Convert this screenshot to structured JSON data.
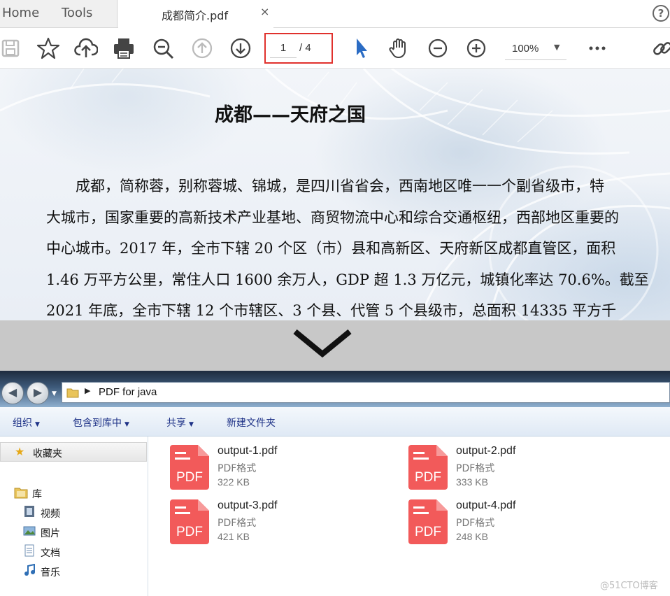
{
  "viewer": {
    "tabs": {
      "home": "Home",
      "tools": "Tools",
      "doc": "成都简介.pdf",
      "close": "×"
    },
    "help": "?",
    "toolbar": {
      "icons": [
        "save-icon",
        "star-icon",
        "upload-icon",
        "print-icon",
        "search-icon",
        "page-up-icon",
        "page-down-icon",
        "cursor-icon",
        "hand-icon",
        "zoom-out-icon",
        "zoom-in-icon",
        "more-icon",
        "link-icon"
      ],
      "page_current": "1",
      "page_total": "/ 4",
      "zoom": "100%"
    },
    "document": {
      "title": "成都——天府之国",
      "lines": [
        "　　成都，简称蓉，别称蓉城、锦城，是四川省省会，西南地区唯一一个副省级市，特",
        "大城市，国家重要的高新技术产业基地、商贸物流中心和综合交通枢纽，西部地区重要的",
        "中心城市。2017 年，全市下辖 20 个区（市）县和高新区、天府新区成都直管区，面积",
        "1.46 万平方公里，常住人口 1600 余万人，GDP 超 1.3 万亿元，城镇化率达 70.6%。截至",
        "2021 年底，全市下辖 12 个市辖区、3 个县、代管 5 个县级市，总面积 14335 平方千"
      ]
    }
  },
  "explorer": {
    "address": "PDF for java",
    "commands": [
      "组织",
      "包含到库中",
      "共享",
      "新建文件夹"
    ],
    "favorites": "收藏夹",
    "tree": {
      "library": "库",
      "items": [
        "视频",
        "图片",
        "文档",
        "音乐"
      ]
    },
    "files": [
      {
        "name": "output-1.pdf",
        "type": "PDF格式",
        "size": "322 KB"
      },
      {
        "name": "output-2.pdf",
        "type": "PDF格式",
        "size": "333 KB"
      },
      {
        "name": "output-3.pdf",
        "type": "PDF格式",
        "size": "421 KB"
      },
      {
        "name": "output-4.pdf",
        "type": "PDF格式",
        "size": "248 KB"
      }
    ],
    "pdf_icon_label": "PDF"
  },
  "watermark": "@51CTO博客",
  "colors": {
    "accent_red": "#e0312d",
    "pdf_icon": "#f25a5a",
    "cursor_blue": "#2b6cc4"
  }
}
